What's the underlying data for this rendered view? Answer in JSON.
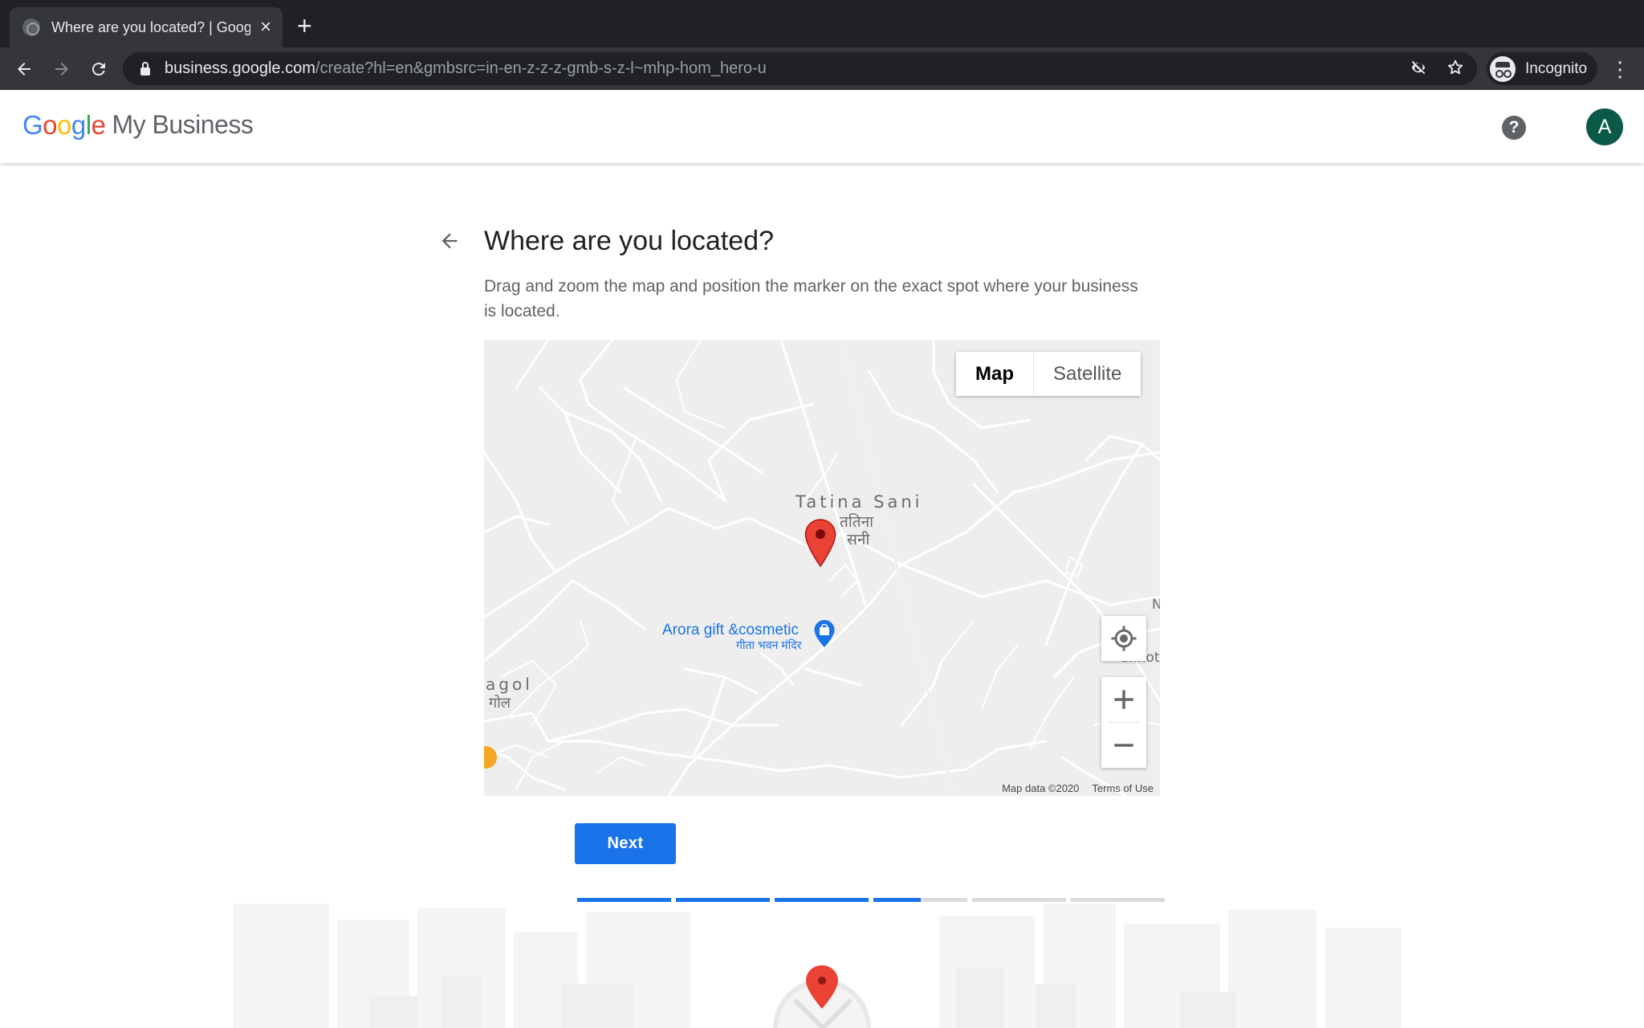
{
  "browser": {
    "tab_title": "Where are you located? | Google My Business",
    "url_host": "business.google.com",
    "url_path": "/create?hl=en&gmbsrc=in-en-z-z-z-gmb-s-z-l~mhp-hom_hero-u",
    "profile_label": "Incognito"
  },
  "header": {
    "logo_letters": [
      "G",
      "o",
      "o",
      "g",
      "l",
      "e"
    ],
    "product_name": "My Business",
    "help_symbol": "?",
    "avatar_letter": "A"
  },
  "page": {
    "title": "Where are you located?",
    "description": "Drag and zoom the map and position the marker on the exact spot where your business is located.",
    "next_label": "Next"
  },
  "map": {
    "type_map": "Map",
    "type_satellite": "Satellite",
    "village_label_en": "Tatina Sani",
    "village_label_hi_1": "ततिना",
    "village_label_hi_2": "सनी",
    "poi_name": "Arora gift &cosmetic",
    "poi_name_hi": "गीता भवन मंदिर",
    "edge_label_left_1": "agol",
    "edge_label_left_2": "गोल",
    "edge_label_right_1": "N",
    "edge_label_right_2": "Chhot",
    "footer_data": "Map data ©2020",
    "footer_terms": "Terms of Use",
    "marker_color": "#ea4335",
    "poi_color": "#1a73e8"
  },
  "progress": {
    "steps": [
      1,
      1,
      1,
      0.5,
      0,
      0
    ],
    "active_color": "#1a73e8"
  },
  "colors": {
    "brand_blue": "#1a73e8",
    "avatar_bg": "#0b5a48"
  },
  "icons": [
    "back-arrow-icon",
    "forward-arrow-icon",
    "reload-icon",
    "lock-icon",
    "eye-off-icon",
    "star-icon",
    "incognito-icon",
    "more-vert-icon",
    "help-icon",
    "map-marker-icon",
    "poi-shopping-icon",
    "my-location-icon",
    "zoom-in-icon",
    "zoom-out-icon"
  ]
}
